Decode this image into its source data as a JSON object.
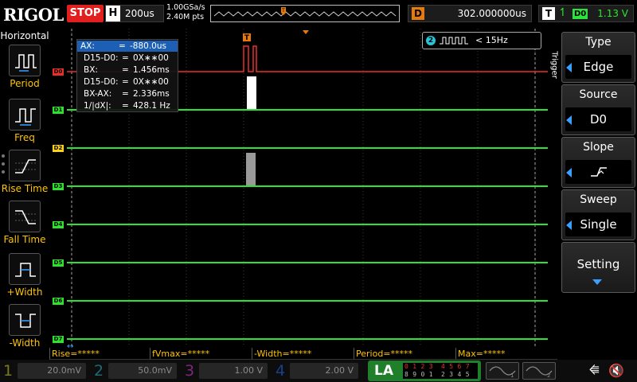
{
  "topbar": {
    "logo": "RIGOL",
    "run_state": "STOP",
    "h_label": "H",
    "timebase": "200us",
    "sample_rate": "1.00GSa/s",
    "memory_depth": "2.40M pts",
    "delay_label": "D",
    "delay_value": "302.000000us",
    "trigger_label": "T",
    "trigger_source": "D0",
    "trigger_level": "1.13 V"
  },
  "left_panel": {
    "title": "Horizontal",
    "items": [
      {
        "label": "Period",
        "icon": "period-icon"
      },
      {
        "label": "Freq",
        "icon": "freq-icon"
      },
      {
        "label": "Rise Time",
        "icon": "rise-time-icon"
      },
      {
        "label": "Fall Time",
        "icon": "fall-time-icon"
      },
      {
        "label": "+Width",
        "icon": "positive-width-icon"
      },
      {
        "label": "-Width",
        "icon": "negative-width-icon"
      }
    ]
  },
  "cursor_readout": {
    "rows": [
      {
        "key": "AX:",
        "eq": "=",
        "value": "-880.0us"
      },
      {
        "key": "D15-D0:",
        "eq": "=",
        "value": "0X∗∗00"
      },
      {
        "key": "BX:",
        "eq": "=",
        "value": "1.456ms"
      },
      {
        "key": "D15-D0:",
        "eq": "=",
        "value": "0X∗∗00"
      },
      {
        "key": "BX-AX:",
        "eq": "=",
        "value": "2.336ms"
      },
      {
        "key": "1/|dX|:",
        "eq": "=",
        "value": "428.1 Hz"
      }
    ]
  },
  "frequency_counter": {
    "channel": "2",
    "value": "< 15Hz"
  },
  "digital_channels": [
    "D0",
    "D1",
    "D2",
    "D3",
    "D4",
    "D5",
    "D6",
    "D7"
  ],
  "colors": {
    "d0": "#e8302a",
    "digital": "#2ee32e",
    "run_stop": "#e21f1f",
    "delay": "#e87a0b",
    "measure_text": "#ffc400",
    "cursor_highlight": "#1d5fb4"
  },
  "trigger_menu": {
    "tab": "Trigger",
    "items": [
      {
        "title": "Type",
        "value": "Edge"
      },
      {
        "title": "Source",
        "value": "D0"
      },
      {
        "title": "Slope",
        "value": "rising-edge-icon"
      },
      {
        "title": "Sweep",
        "value": "Single"
      },
      {
        "title": "Setting",
        "value": ""
      }
    ]
  },
  "measure_strip": [
    "Rise=*****",
    "fVmax=*****",
    "-Width=*****",
    "Period=*****",
    "Max=*****"
  ],
  "bottom_channels": [
    {
      "num": "1",
      "value": "20.0mV",
      "color": "#7a7a18"
    },
    {
      "num": "2",
      "value": "50.0mV",
      "color": "#1a6c78"
    },
    {
      "num": "3",
      "value": "1.00 V",
      "color": "#7a2a7a"
    },
    {
      "num": "4",
      "value": "2.00 V",
      "color": "#1a3f8a"
    }
  ],
  "la": {
    "label": "LA",
    "row1": "0 1 2 3  4 5 6 7",
    "row2": "8 9 0 1  2 3 4 5"
  }
}
